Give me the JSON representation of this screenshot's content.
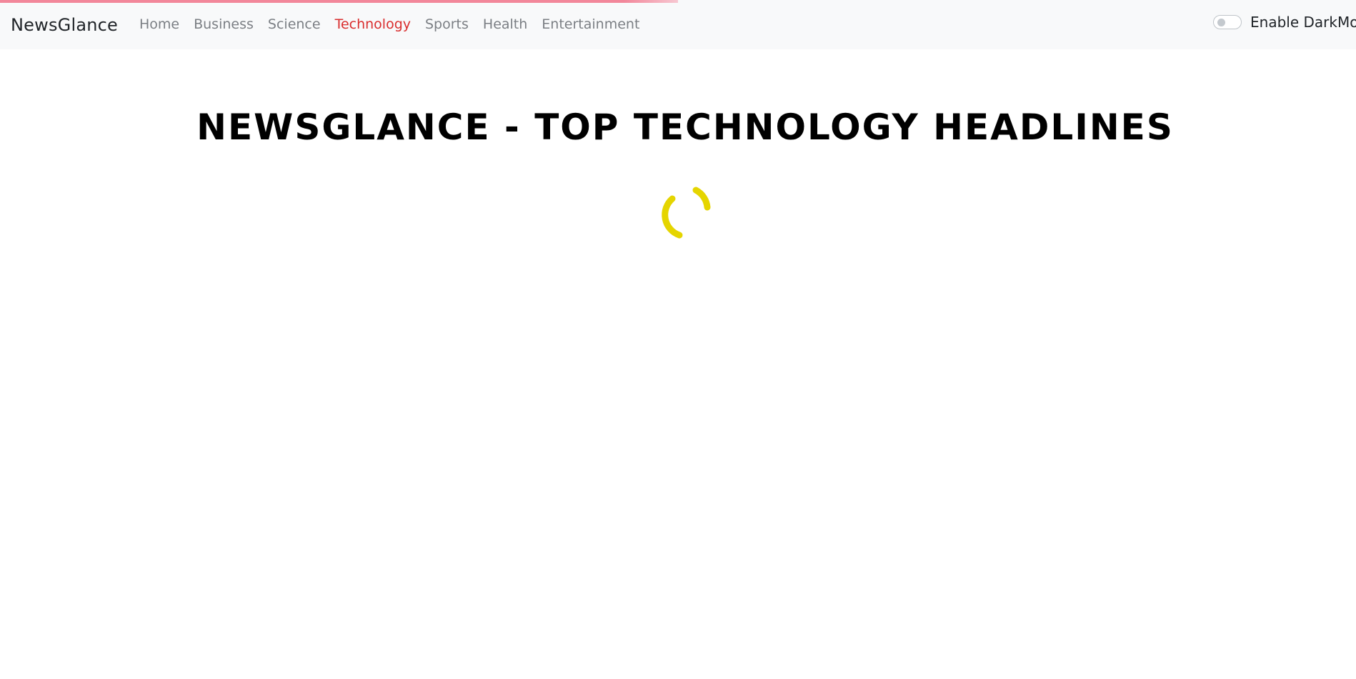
{
  "navbar": {
    "brand": "NewsGlance",
    "links": [
      {
        "label": "Home",
        "active": false
      },
      {
        "label": "Business",
        "active": false
      },
      {
        "label": "Science",
        "active": false
      },
      {
        "label": "Technology",
        "active": true
      },
      {
        "label": "Sports",
        "active": false
      },
      {
        "label": "Health",
        "active": false
      },
      {
        "label": "Entertainment",
        "active": false
      }
    ],
    "dark_mode_label": "Enable DarkMode",
    "dark_mode_enabled": false
  },
  "main": {
    "heading": "NEWSGLANCE - TOP TECHNOLOGY HEADLINES",
    "loading_spinner": "spinner-icon"
  },
  "page_loading_progress": 0.5,
  "colors": {
    "navbar_background": "#f8f9fa",
    "active_link": "#d92d2d",
    "link": "#7b7f84",
    "spinner": "#e5d500",
    "loading_bar": "#f2879a"
  }
}
